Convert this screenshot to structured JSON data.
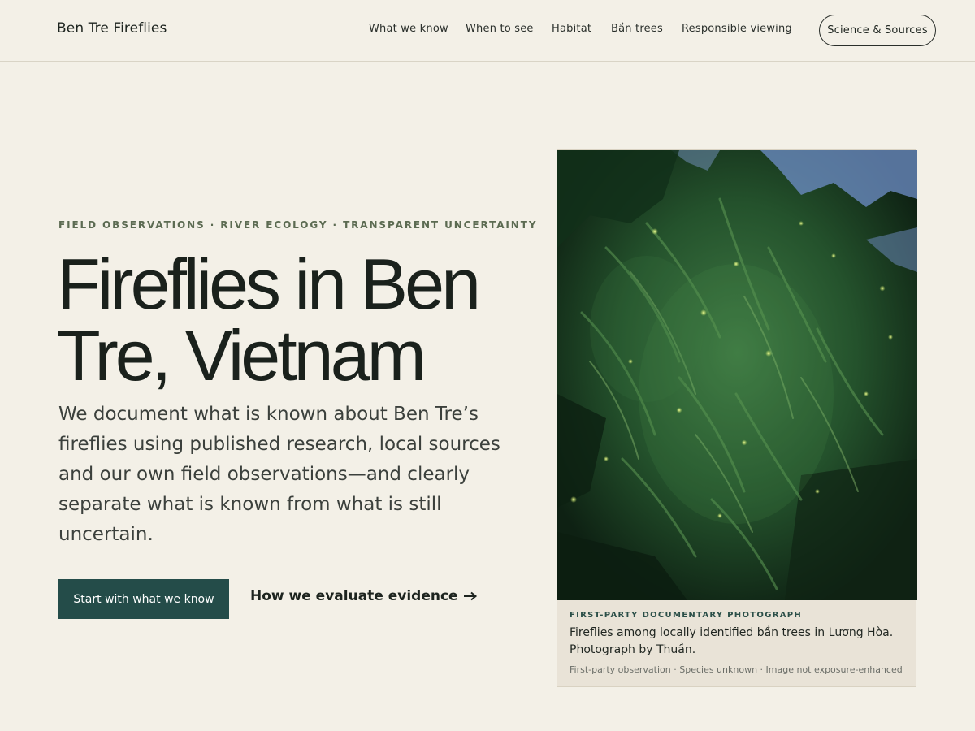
{
  "header": {
    "brand": "Ben Tre Fireflies",
    "nav": [
      {
        "label": "What we know"
      },
      {
        "label": "When to see"
      },
      {
        "label": "Habitat"
      },
      {
        "label": "Bần trees"
      },
      {
        "label": "Responsible viewing"
      }
    ],
    "cta_label": "Science & Sources"
  },
  "hero": {
    "eyebrow": "FIELD OBSERVATIONS · RIVER ECOLOGY · TRANSPARENT UNCERTAINTY",
    "title": "Fireflies in Ben Tre, Vietnam",
    "lede": "We document what is known about Ben Tre’s fireflies using published research, local sources and our own field observations—and clearly separate what is known from what is still uncertain.",
    "primary_button": "Start with what we know",
    "secondary_link": "How we evaluate evidence",
    "secondary_link_icon": "arrow-right-icon"
  },
  "figure": {
    "kicker": "FIRST-PARTY DOCUMENTARY PHOTOGRAPH",
    "caption": "Fireflies among locally identified bần trees in Lương Hòa. Photograph by Thuần.",
    "meta": "First-party observation · Species unknown · Image not exposure-enhanced"
  },
  "colors": {
    "background": "#f3f0e7",
    "accent": "#244c49",
    "eyebrow": "#5c6b52",
    "caption_bg": "#e9e3d7"
  }
}
